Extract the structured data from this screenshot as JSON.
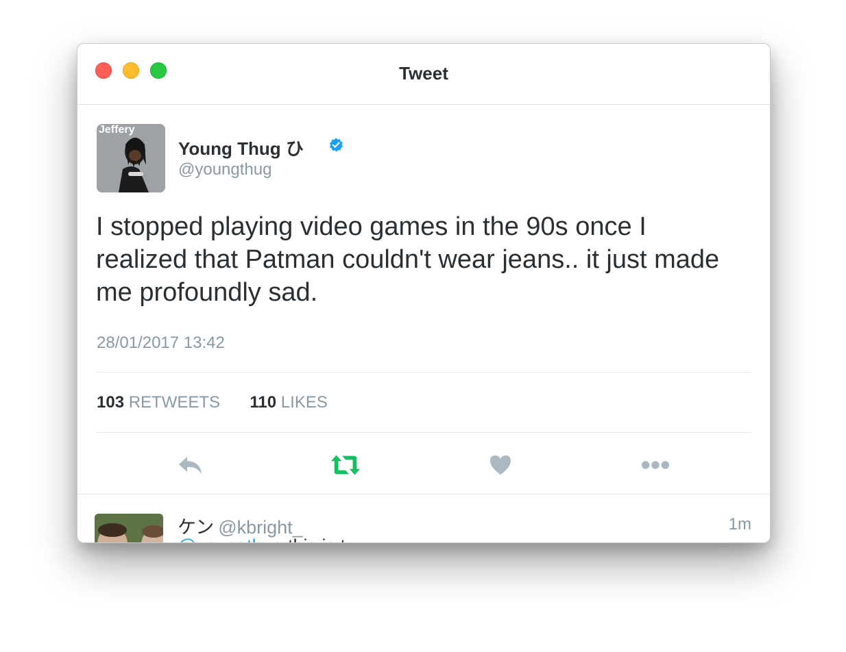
{
  "window": {
    "title": "Tweet",
    "controls": {
      "close": "close-button",
      "minimize": "minimize-button",
      "zoom": "zoom-button"
    }
  },
  "tweet": {
    "avatar_caption": "Jeffery",
    "display_name": "Young Thug ひ",
    "verified": true,
    "handle": "@youngthug",
    "text": "I stopped playing video games in the 90s once I realized that Patman couldn't wear jeans.. it just made me profoundly sad.",
    "timestamp": "28/01/2017 13:42",
    "retweets_count": "103",
    "retweets_label": "RETWEETS",
    "likes_count": "110",
    "likes_label": "LIKES"
  },
  "actions": [
    {
      "name": "reply",
      "icon": "reply-icon"
    },
    {
      "name": "retweet",
      "icon": "retweet-icon",
      "active": true
    },
    {
      "name": "like",
      "icon": "heart-icon"
    },
    {
      "name": "more",
      "icon": "more-icon"
    }
  ],
  "reply": {
    "display_name": "ケン",
    "handle": "@kbright_",
    "time": "1m",
    "preview_mention": "@youngthug",
    "preview_text": " this is t"
  },
  "colors": {
    "text": "#292f33",
    "muted": "#8899a6",
    "retweet_active": "#17bf63",
    "verified": "#1da1f2",
    "icon_inactive": "#aab8c2"
  }
}
